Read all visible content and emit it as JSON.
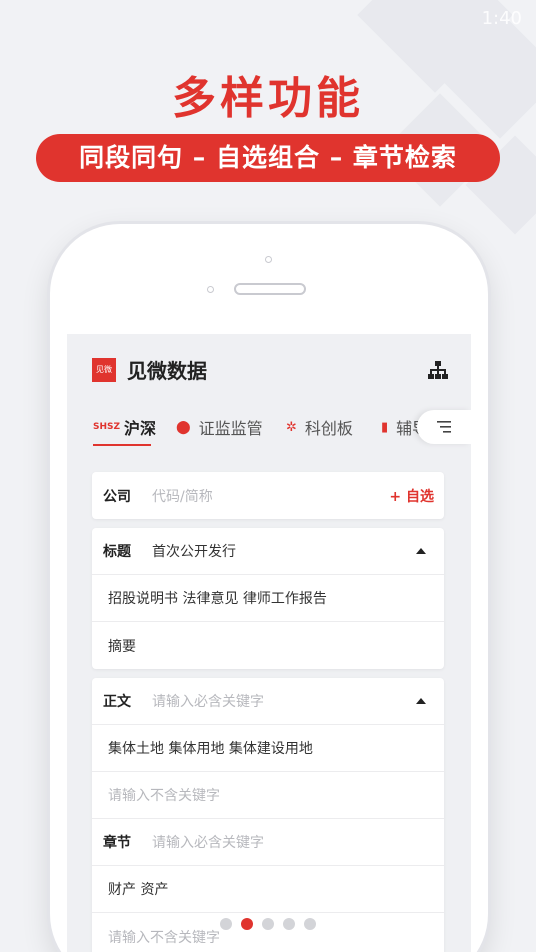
{
  "status_bar": {
    "time": "1:40"
  },
  "promo": {
    "headline": "多样功能",
    "banner": "同段同句 – 自选组合 – 章节检索"
  },
  "app": {
    "logo_text": "见微",
    "title": "见微数据",
    "header_icon": "sitemap-icon"
  },
  "tabs": [
    {
      "icon_text": "SHSZ",
      "label": "沪深",
      "active": true
    },
    {
      "icon_text": "⬤",
      "label": "证监监管",
      "active": false
    },
    {
      "icon_text": "✲",
      "label": "科创板",
      "active": false
    },
    {
      "icon_text": "▮",
      "label": "辅导",
      "active": false
    }
  ],
  "tabs_more_icon": "menu-lines-icon",
  "company": {
    "label": "公司",
    "placeholder": "代码/简称",
    "action": "+ 自选"
  },
  "title_section": {
    "label": "标题",
    "value": "首次公开发行",
    "chips": "招股说明书 法律意见 律师工作报告",
    "summary": "摘要"
  },
  "body_section": {
    "label": "正文",
    "include_placeholder": "请输入必含关键字",
    "include_value": "集体土地 集体用地 集体建设用地",
    "exclude_placeholder": "请输入不含关键字"
  },
  "chapter_section": {
    "label": "章节",
    "include_placeholder": "请输入必含关键字",
    "include_value": "财产 资产",
    "exclude_placeholder": "请输入不含关键字"
  },
  "pagination": {
    "total": 5,
    "active_index": 1
  },
  "colors": {
    "accent": "#e0342e",
    "background": "#f1f2f5",
    "card": "#ffffff"
  }
}
